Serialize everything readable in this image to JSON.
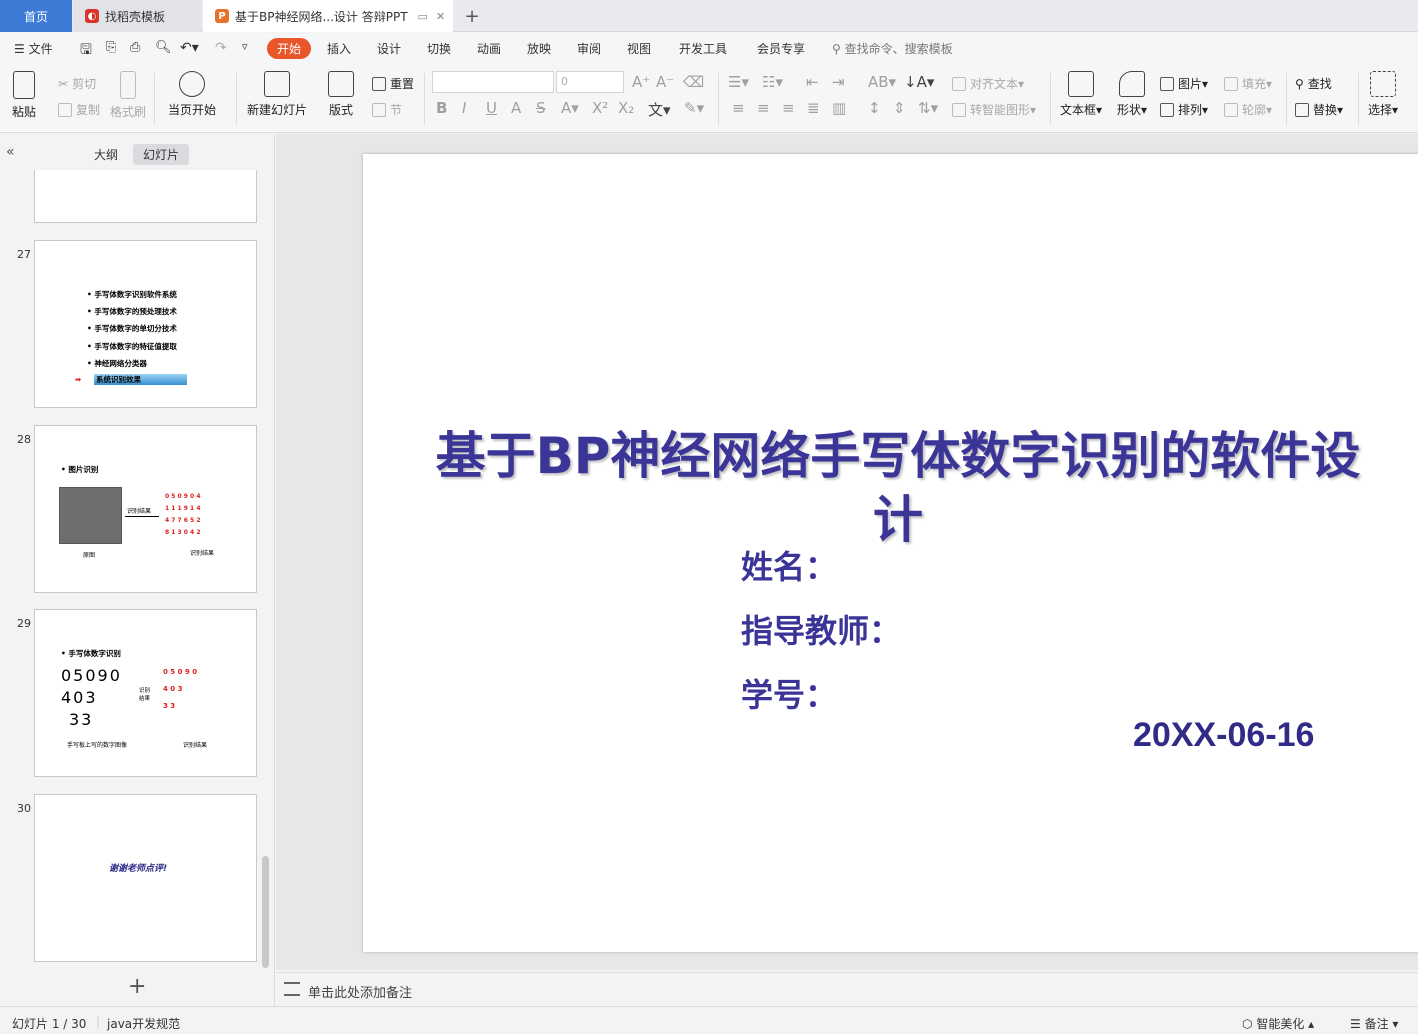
{
  "tabs": {
    "home": "首页",
    "template": "找稻壳模板",
    "document": "基于BP神经网络...设计 答辩PPT"
  },
  "menu": {
    "file": "文件",
    "items": [
      "开始",
      "插入",
      "设计",
      "切换",
      "动画",
      "放映",
      "审阅",
      "视图",
      "开发工具",
      "会员专享"
    ],
    "search_placeholder": "查找命令、搜索模板"
  },
  "ribbon": {
    "paste": "粘贴",
    "cut": "剪切",
    "copy": "复制",
    "format_painter": "格式刷",
    "play_from_current": "当页开始",
    "new_slide": "新建幻灯片",
    "layout": "版式",
    "reset": "重置",
    "section": "节",
    "font_size_value": "0",
    "align_text": "对齐文本",
    "smart_shape": "转智能图形",
    "text_box": "文本框",
    "shape": "形状",
    "picture": "图片",
    "arrange": "排列",
    "fill": "填充",
    "outline": "轮廓",
    "find": "查找",
    "replace": "替换",
    "select": "选择"
  },
  "left_panel": {
    "tab_outline": "大纲",
    "tab_slides": "幻灯片",
    "thumbnails": [
      {
        "number": "27",
        "bullets": [
          "手写体数字识别软件系统",
          "手写体数字的预处理技术",
          "手写体数字的单切分技术",
          "手写体数字的特征值提取",
          "神经网络分类器",
          "系统识别效果"
        ]
      },
      {
        "number": "28",
        "heading": "图片识别",
        "arrow_label": "识别结果",
        "left_caption": "原图",
        "right_caption": "识别结果",
        "rows": [
          "0 5 0 9 0 4",
          "1 1 1 9 1 4",
          "4 7 7 6 5 2",
          "8 1 3 0 4 2"
        ]
      },
      {
        "number": "29",
        "heading": "手写体数字识别",
        "hand_lines": [
          "05090",
          "403",
          "33"
        ],
        "arrow_label": "识别结果",
        "rows": [
          "0 5 0 9 0",
          "4 0 3",
          "3 3"
        ],
        "left_caption": "手写板上写的数字图像",
        "right_caption": "识别结果"
      },
      {
        "number": "30",
        "text": "谢谢老师点评!"
      }
    ]
  },
  "slide": {
    "title": "基于BP神经网络手写体数字识别的软件设计",
    "name_label": "姓名：",
    "teacher_label": "指导教师：",
    "student_id_label": "学号：",
    "date": "20XX-06-16"
  },
  "notes": {
    "placeholder": "单击此处添加备注"
  },
  "status": {
    "slide_counter": "幻灯片 1 / 30",
    "theme_name": "java开发规范",
    "beautify": "智能美化",
    "notes": "备注"
  },
  "colors": {
    "accent": "#e8562a",
    "home_tab": "#3c7cd6",
    "title": "#3a3596"
  }
}
